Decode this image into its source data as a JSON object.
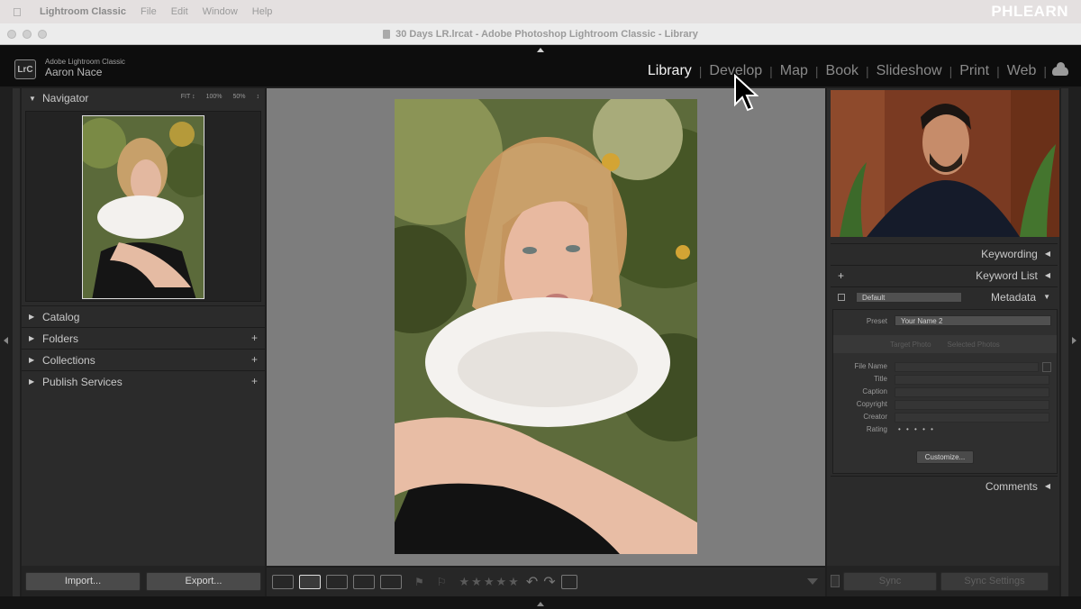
{
  "menubar": {
    "app_name": "Lightroom Classic",
    "items": [
      "File",
      "Edit",
      "Window",
      "Help"
    ],
    "watermark": "PHLEARN"
  },
  "window": {
    "title": "30 Days LR.lrcat - Adobe Photoshop Lightroom Classic - Library"
  },
  "identity": {
    "logo_text": "LrC",
    "product": "Adobe Lightroom Classic",
    "user": "Aaron Nace"
  },
  "modules": {
    "active": "Library",
    "items": [
      "Library",
      "Develop",
      "Map",
      "Book",
      "Slideshow",
      "Print",
      "Web"
    ]
  },
  "left_panel": {
    "navigator": {
      "label": "Navigator",
      "zoom_options": [
        "FIT ↕",
        "100%",
        "50%",
        "↕"
      ]
    },
    "sections": [
      {
        "label": "Catalog",
        "has_plus": false
      },
      {
        "label": "Folders",
        "has_plus": true
      },
      {
        "label": "Collections",
        "has_plus": true
      },
      {
        "label": "Publish Services",
        "has_plus": true
      }
    ],
    "import_label": "Import...",
    "export_label": "Export..."
  },
  "toolbar": {
    "stars": "★★★★★"
  },
  "right_panel": {
    "keywording": "Keywording",
    "keyword_list": "Keyword List",
    "metadata": {
      "header": "Metadata",
      "preset_dropdown": "Default",
      "preset_label": "Preset",
      "preset_value": "Your Name 2",
      "target_photo": "Target Photo",
      "selected_photos": "Selected Photos",
      "fields": [
        "File Name",
        "Title",
        "Caption",
        "Copyright",
        "Creator",
        "Rating"
      ],
      "rating_dots": "• • • • •",
      "customize_label": "Customize..."
    },
    "comments": "Comments",
    "sync_label": "Sync",
    "sync_settings_label": "Sync Settings"
  },
  "colors": {
    "accent_text": "#f2f2f2",
    "panel_bg": "#2b2b2b",
    "workspace_bg": "#7d7d7d"
  }
}
